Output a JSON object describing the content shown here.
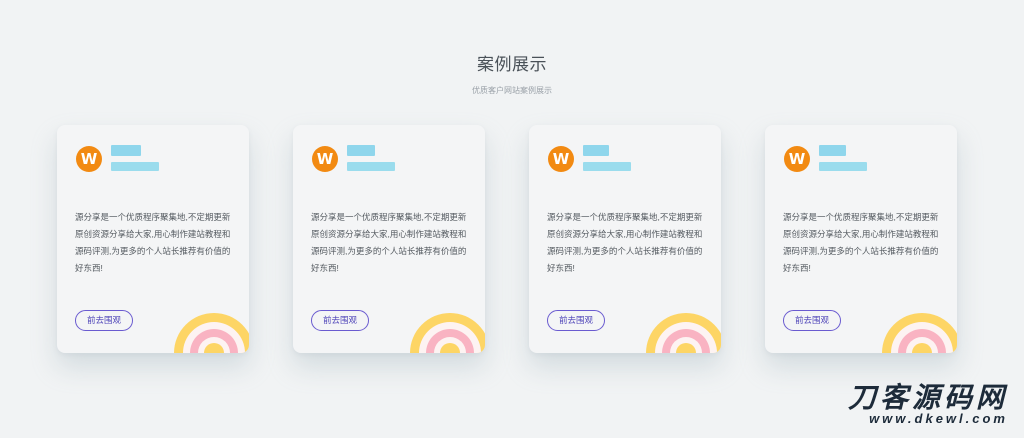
{
  "section": {
    "title": "案例展示",
    "subtitle": "优质客户网站案例展示"
  },
  "cards": [
    {
      "avatar_letter": "W",
      "description": "源分享是一个优质程序聚集地,不定期更新原创资源分享给大家,用心制作建站教程和源码评测,为更多的个人站长推荐有价值的好东西!",
      "button_label": "前去围观"
    },
    {
      "avatar_letter": "W",
      "description": "源分享是一个优质程序聚集地,不定期更新原创资源分享给大家,用心制作建站教程和源码评测,为更多的个人站长推荐有价值的好东西!",
      "button_label": "前去围观"
    },
    {
      "avatar_letter": "W",
      "description": "源分享是一个优质程序聚集地,不定期更新原创资源分享给大家,用心制作建站教程和源码评测,为更多的个人站长推荐有价值的好东西!",
      "button_label": "前去围观"
    },
    {
      "avatar_letter": "W",
      "description": "源分享是一个优质程序聚集地,不定期更新原创资源分享给大家,用心制作建站教程和源码评测,为更多的个人站长推荐有价值的好东西!",
      "button_label": "前去围观"
    }
  ],
  "watermark": {
    "main": "刀客源码网",
    "sub": "www.dkewl.com"
  },
  "colors": {
    "background": "#f1f3f4",
    "card": "#f4f5f6",
    "avatar": "#f28a12",
    "redacted_text_block": "#8fd6ec",
    "button_border": "#6a5bd0",
    "rainbow_outer": "#fdd565",
    "rainbow_pink": "#f9b3c2"
  },
  "icons": {
    "avatar": "w-logo-icon",
    "decoration": "rainbow-icon"
  }
}
